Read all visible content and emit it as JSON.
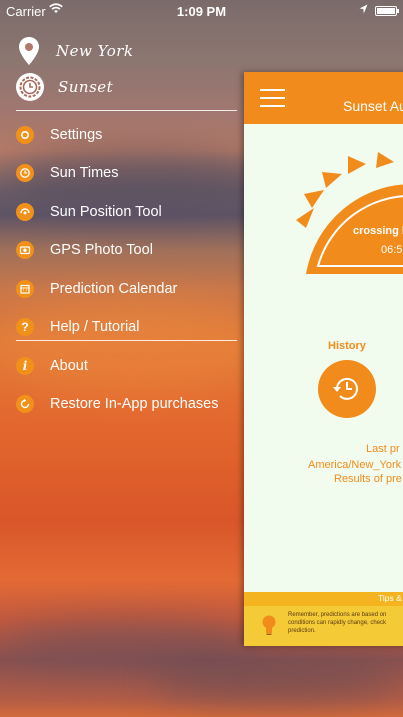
{
  "status_bar": {
    "carrier": "Carrier",
    "time": "1:09 PM",
    "battery_level": 1.0
  },
  "header": {
    "location": "New York",
    "mode": "Sunset"
  },
  "menu": {
    "items": [
      {
        "label": "Settings",
        "icon": "gear-icon"
      },
      {
        "label": "Sun Times",
        "icon": "clock-icon"
      },
      {
        "label": "Sun Position Tool",
        "icon": "sun-position-icon"
      },
      {
        "label": "GPS Photo Tool",
        "icon": "photo-icon"
      },
      {
        "label": "Prediction Calendar",
        "icon": "calendar-icon"
      },
      {
        "label": "Help / Tutorial",
        "icon": "help-icon"
      },
      {
        "label": "About",
        "icon": "info-icon"
      },
      {
        "label": "Restore In-App purchases",
        "icon": "restore-icon"
      }
    ]
  },
  "app": {
    "title": "Sunset Au",
    "crossing": "crossing h",
    "crossing_time": "06:5",
    "history_label": "History",
    "last_line1": "Last pr",
    "last_line2": "America/New_York",
    "last_line3": "Results of pre",
    "tips_label": "Tips &",
    "tip_line1": "Remember, predictions are based on",
    "tip_line2": "conditions can rapidly change, check",
    "tip_line3": "prediction."
  },
  "colors": {
    "accent": "#f18c1c",
    "card_bg": "#f1fbee",
    "tip_bg": "#f4ca37"
  }
}
